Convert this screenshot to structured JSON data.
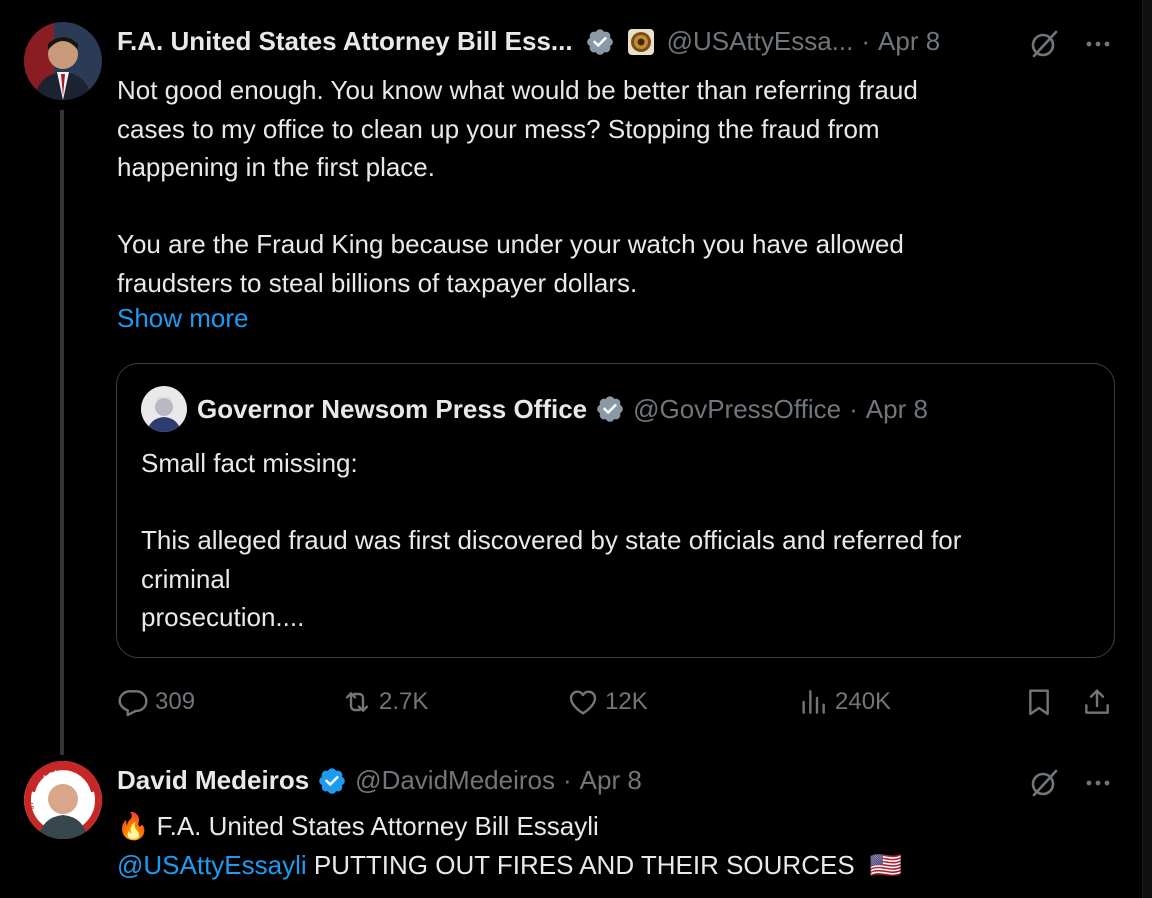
{
  "tweet1": {
    "name": "F.A. United States Attorney Bill Ess...",
    "handle": "@USAttyEssa...",
    "sep": "·",
    "date": "Apr 8",
    "text": "Not good enough. You know what would be better than referring fraud\ncases to my office to clean up your mess? Stopping the fraud from\nhappening in the first place.\n\nYou are the Fraud King because under your watch you have allowed\nfraudsters to steal billions of taxpayer dollars.",
    "show_more": "Show more",
    "quote": {
      "name": "Governor Newsom Press Office",
      "handle": "@GovPressOffice",
      "sep": "·",
      "date": "Apr 8",
      "text": "Small fact missing:\n\nThis alleged fraud was first discovered by state officials and referred for\ncriminal\nprosecution...."
    },
    "actions": {
      "replies": "309",
      "reposts": "2.7K",
      "likes": "12K",
      "views": "240K"
    }
  },
  "tweet2": {
    "name": "David Medeiros",
    "handle": "@DavidMedeiros",
    "sep": "·",
    "date": "Apr 8",
    "line1_emoji": "🔥",
    "line1_text": "F.A. United States Attorney Bill Essayli",
    "mention": "@USAttyEssayli",
    "line2_text": "PUTTING OUT FIRES AND THEIR SOURCES",
    "flag_emoji": "🇺🇸"
  },
  "colors": {
    "background": "#000000",
    "text": "#e7e9ea",
    "secondary": "#71767b",
    "link": "#1d9bf0",
    "verified": "#1d9bf0",
    "border": "#3a3d41"
  },
  "icons": [
    "verified-badge-icon",
    "doj-seal-icon",
    "grok-icon",
    "more-icon",
    "reply-icon",
    "repost-icon",
    "like-icon",
    "views-icon",
    "bookmark-icon",
    "share-icon",
    "fire-emoji",
    "us-flag-emoji"
  ]
}
